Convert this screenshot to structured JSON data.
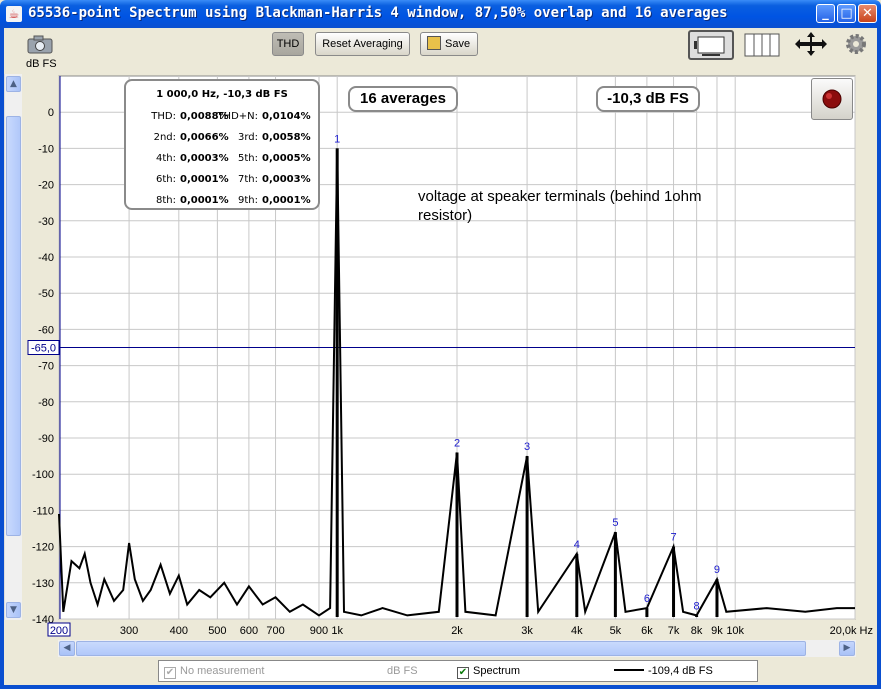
{
  "window": {
    "title": "65536-point Spectrum using Blackman-Harris 4 window, 87,50% overlap and 16 averages"
  },
  "toolbar": {
    "thd_label": "THD",
    "reset_label": "Reset Averaging",
    "save_label": "Save"
  },
  "y_axis_unit": "dB FS",
  "overlays": {
    "averages_label": "16 averages",
    "level_label": "-10,3 dB FS",
    "annotation": [
      "voltage at speaker terminals (behind 1ohm",
      "resistor)"
    ],
    "cursor_label": "-65,0"
  },
  "thd_box": {
    "header": "1 000,0 Hz, -10,3 dB FS",
    "rows": [
      {
        "l1": "THD:",
        "v1": "0,0088%",
        "l2": "THD+N:",
        "v2": "0,0104%"
      },
      {
        "l1": "2nd:",
        "v1": "0,0066%",
        "l2": "3rd:",
        "v2": "0,0058%"
      },
      {
        "l1": "4th:",
        "v1": "0,0003%",
        "l2": "5th:",
        "v2": "0,0005%"
      },
      {
        "l1": "6th:",
        "v1": "0,0001%",
        "l2": "7th:",
        "v2": "0,0003%"
      },
      {
        "l1": "8th:",
        "v1": "0,0001%",
        "l2": "9th:",
        "v2": "0,0001%"
      }
    ]
  },
  "legend": {
    "item1": "No measurement",
    "item1_unit": "dB FS",
    "item2": "Spectrum",
    "item2_value": "-109,4 dB FS"
  },
  "chart_data": {
    "type": "line",
    "xlabel": "Hz",
    "ylabel": "dB FS",
    "x_scale": "log",
    "xlim": [
      200,
      20000
    ],
    "ylim": [
      -140,
      10
    ],
    "y_ticks": [
      0,
      -10,
      -20,
      -30,
      -40,
      -50,
      -60,
      -70,
      -80,
      -90,
      -100,
      -110,
      -120,
      -130,
      -140
    ],
    "x_ticks": [
      {
        "v": 200,
        "label": "200"
      },
      {
        "v": 300,
        "label": "300"
      },
      {
        "v": 400,
        "label": "400"
      },
      {
        "v": 500,
        "label": "500"
      },
      {
        "v": 600,
        "label": "600"
      },
      {
        "v": 700,
        "label": "700"
      },
      {
        "v": 900,
        "label": "900"
      },
      {
        "v": 1000,
        "label": "1k"
      },
      {
        "v": 2000,
        "label": "2k"
      },
      {
        "v": 3000,
        "label": "3k"
      },
      {
        "v": 4000,
        "label": "4k"
      },
      {
        "v": 5000,
        "label": "5k"
      },
      {
        "v": 6000,
        "label": "6k"
      },
      {
        "v": 7000,
        "label": "7k"
      },
      {
        "v": 8000,
        "label": "8k"
      },
      {
        "v": 9000,
        "label": "9k"
      },
      {
        "v": 10000,
        "label": "10k"
      },
      {
        "v": 20000,
        "label": "20,0k Hz"
      }
    ],
    "grid": true,
    "cursor_db": -65,
    "harmonics": [
      {
        "n": "1",
        "freq": 1000,
        "db": -10
      },
      {
        "n": "2",
        "freq": 2000,
        "db": -94
      },
      {
        "n": "3",
        "freq": 3000,
        "db": -95
      },
      {
        "n": "4",
        "freq": 4000,
        "db": -122
      },
      {
        "n": "5",
        "freq": 5000,
        "db": -116
      },
      {
        "n": "6",
        "freq": 6000,
        "db": -137
      },
      {
        "n": "7",
        "freq": 7000,
        "db": -120
      },
      {
        "n": "8",
        "freq": 8000,
        "db": -139
      },
      {
        "n": "9",
        "freq": 9000,
        "db": -129
      }
    ],
    "noise_floor": [
      [
        200,
        -111
      ],
      [
        205,
        -138
      ],
      [
        210,
        -131
      ],
      [
        215,
        -124
      ],
      [
        225,
        -126
      ],
      [
        232,
        -122
      ],
      [
        240,
        -130
      ],
      [
        250,
        -136
      ],
      [
        260,
        -129
      ],
      [
        275,
        -135
      ],
      [
        290,
        -132
      ],
      [
        300,
        -119
      ],
      [
        310,
        -129
      ],
      [
        325,
        -135
      ],
      [
        340,
        -132
      ],
      [
        360,
        -125
      ],
      [
        380,
        -133
      ],
      [
        400,
        -128
      ],
      [
        420,
        -136
      ],
      [
        450,
        -132
      ],
      [
        480,
        -134
      ],
      [
        520,
        -130
      ],
      [
        560,
        -136
      ],
      [
        600,
        -131
      ],
      [
        650,
        -136
      ],
      [
        700,
        -134
      ],
      [
        760,
        -138
      ],
      [
        820,
        -136
      ],
      [
        900,
        -139
      ],
      [
        960,
        -137
      ],
      [
        1000,
        -10
      ],
      [
        1040,
        -138
      ],
      [
        1150,
        -139
      ],
      [
        1300,
        -137
      ],
      [
        1500,
        -139
      ],
      [
        1800,
        -138
      ],
      [
        2000,
        -94
      ],
      [
        2100,
        -138
      ],
      [
        2500,
        -139
      ],
      [
        3000,
        -95
      ],
      [
        3200,
        -138
      ],
      [
        4000,
        -122
      ],
      [
        4200,
        -138
      ],
      [
        5000,
        -116
      ],
      [
        5300,
        -138
      ],
      [
        6000,
        -137
      ],
      [
        7000,
        -120
      ],
      [
        7400,
        -138
      ],
      [
        8000,
        -139
      ],
      [
        9000,
        -129
      ],
      [
        9500,
        -138
      ],
      [
        12000,
        -137
      ],
      [
        15000,
        -138
      ],
      [
        18000,
        -137
      ],
      [
        20000,
        -137
      ]
    ]
  }
}
